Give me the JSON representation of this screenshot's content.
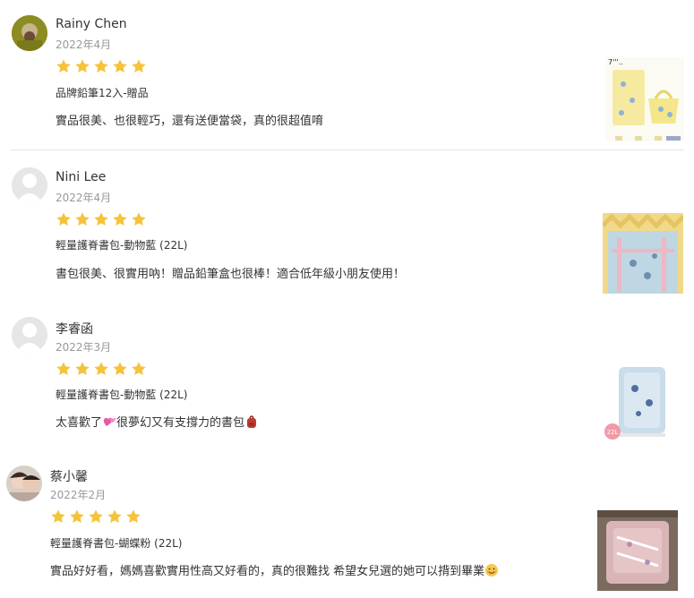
{
  "reviews": [
    {
      "user": "Rainy Chen",
      "date": "2022年4月",
      "rating": 5,
      "variant": "品牌鉛筆12入-贈品",
      "text": "實品很美、也很輕巧，還有送便當袋，真的很超值唷",
      "avatar": "photo-avatar",
      "thumb_caption": "7'''.."
    },
    {
      "user": "Nini Lee",
      "date": "2022年4月",
      "rating": 5,
      "variant": "輕量護脊書包-動物藍 (22L)",
      "text": "書包很美、很實用吶！贈品鉛筆盒也很棒！適合低年級小朋友使用！",
      "avatar": "default-avatar"
    },
    {
      "user": "李睿函",
      "date": "2022年3月",
      "rating": 5,
      "variant": "輕量護脊書包-動物藍 (22L)",
      "text_before": "太喜歡了",
      "text_middle": "很夢幻又有支撐力的書包",
      "avatar": "default-avatar",
      "thumb_badge": "22L"
    },
    {
      "user": "蔡小馨",
      "date": "2022年2月",
      "rating": 5,
      "variant": "輕量護脊書包-蝴蝶粉 (22L)",
      "text": "實品好好看，媽媽喜歡實用性高又好看的，真的很難找 希望女兒選的她可以揹到畢業",
      "avatar": "photo-avatar"
    }
  ],
  "colors": {
    "star": "#f5c33b",
    "divider": "#e6e6e6"
  }
}
